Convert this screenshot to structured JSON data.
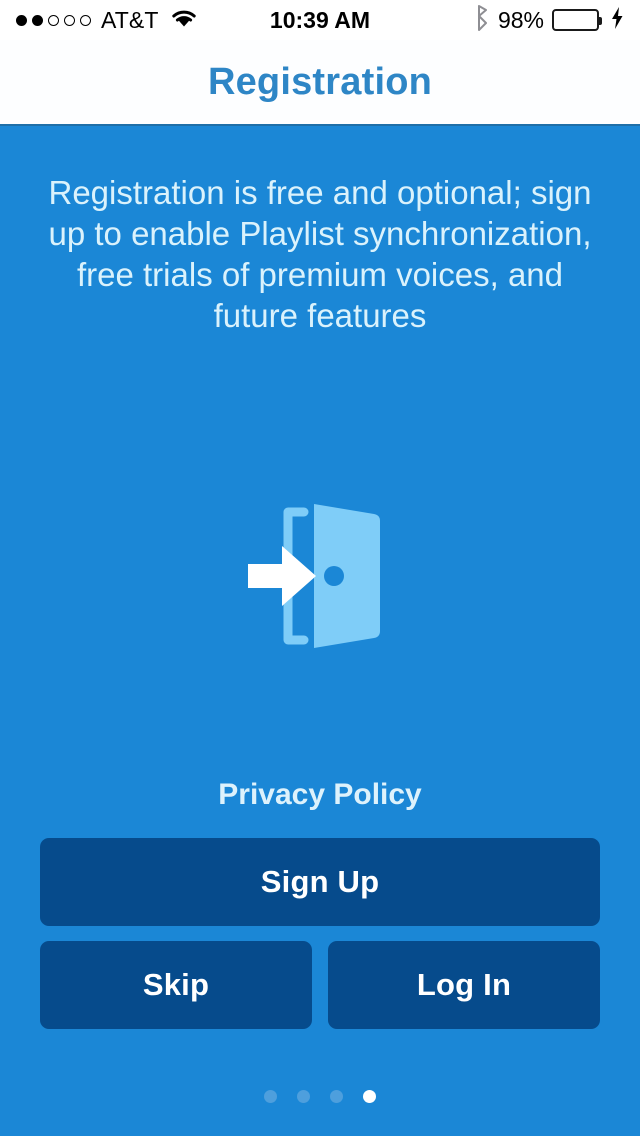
{
  "status_bar": {
    "signal_dots_filled": 2,
    "signal_dots_total": 5,
    "carrier": "AT&T",
    "wifi_icon": "wifi-icon",
    "time": "10:39 AM",
    "bluetooth_icon": "bluetooth-icon",
    "battery_percent": "98%",
    "battery_level": 95,
    "battery_color": "#4cd964",
    "charging_icon": "lightning-bolt-icon"
  },
  "nav": {
    "title": "Registration",
    "title_color": "#2e86c6"
  },
  "content": {
    "background_color": "#1b87d6",
    "intro_text": "Registration is free and optional; sign up to enable Playlist synchronization, free trials of premium voices, and future features",
    "hero_icon": "sign-in-door-icon",
    "hero_icon_colors": {
      "door": "#7fcdf8",
      "arrow": "#ffffff",
      "frame": "#7fcdf8"
    },
    "privacy_policy_label": "Privacy Policy"
  },
  "buttons": {
    "color": "#064b8c",
    "text_color": "#ffffff",
    "sign_up": "Sign Up",
    "skip": "Skip",
    "log_in": "Log In"
  },
  "pagination": {
    "total": 4,
    "active_index": 4,
    "active_color": "#ffffff",
    "inactive_color": "#4e9fdd"
  }
}
